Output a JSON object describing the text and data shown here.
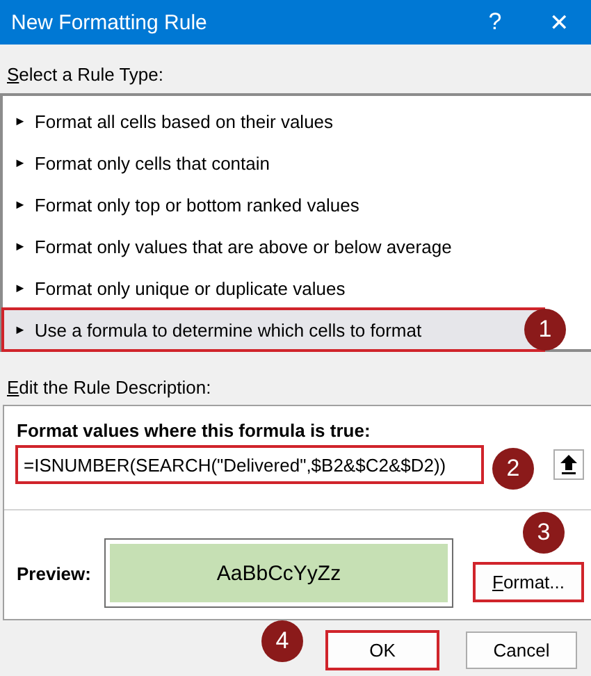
{
  "window": {
    "title": "New Formatting Rule",
    "help": "?",
    "close": "✕"
  },
  "rule_type": {
    "label": "Select a Rule Type:",
    "items": [
      {
        "marker": "►",
        "label": "Format all cells based on their values",
        "selected": false,
        "annotated": false
      },
      {
        "marker": "►",
        "label": "Format only cells that contain",
        "selected": false,
        "annotated": false
      },
      {
        "marker": "►",
        "label": "Format only top or bottom ranked values",
        "selected": false,
        "annotated": false
      },
      {
        "marker": "►",
        "label": "Format only values that are above or below average",
        "selected": false,
        "annotated": false
      },
      {
        "marker": "►",
        "label": "Format only unique or duplicate values",
        "selected": false,
        "annotated": false
      },
      {
        "marker": "►",
        "label": "Use a formula to determine which cells to format",
        "selected": true,
        "annotated": true,
        "badge": "1"
      }
    ]
  },
  "description": {
    "label": "Edit the Rule Description:",
    "formula_label": "Format values where this formula is true:",
    "formula": {
      "value": "=ISNUMBER(SEARCH(\"Delivered\",$B2&$C2&$D2))",
      "annotated": true,
      "badge": "2"
    },
    "preview_label": "Preview:",
    "preview_text": "AaBbCcYyZz",
    "format_button": {
      "label": "Format...",
      "annotated": true,
      "badge": "3"
    }
  },
  "buttons": [
    {
      "label": "OK",
      "annotated": true,
      "badge": "4"
    },
    {
      "label": "Cancel",
      "annotated": false
    }
  ]
}
